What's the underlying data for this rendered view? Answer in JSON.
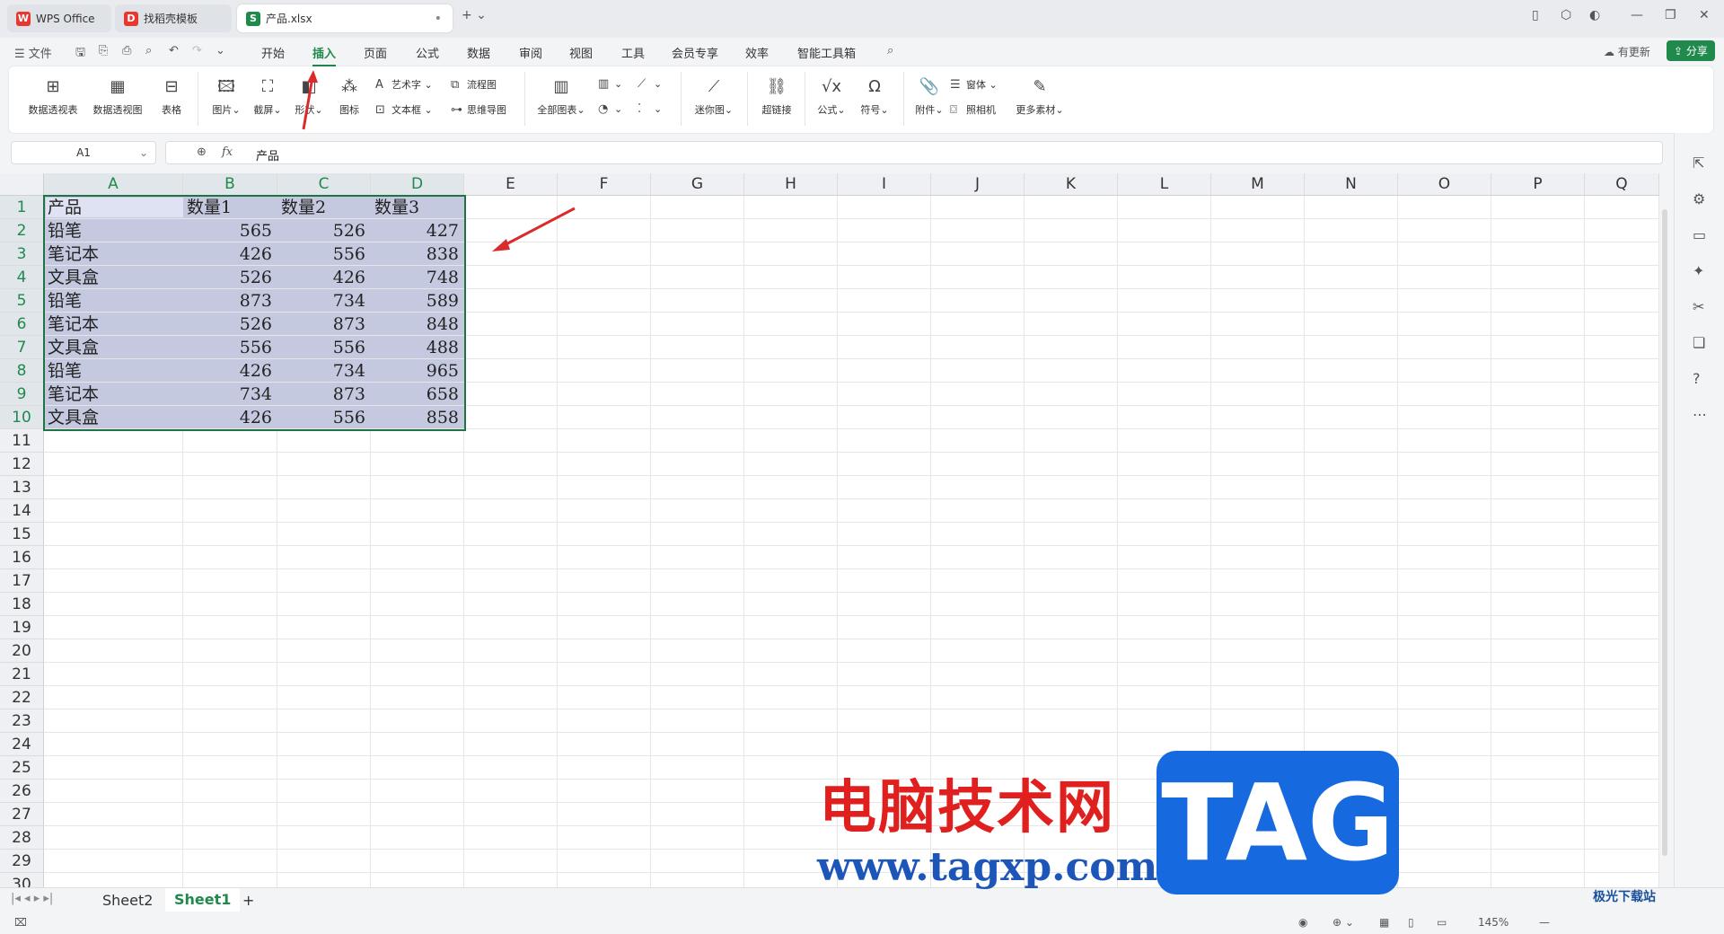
{
  "tabs": [
    {
      "label": "WPS Office",
      "icon": "W",
      "color": "#e7372f"
    },
    {
      "label": "找稻壳模板",
      "icon": "D",
      "color": "#e7372f"
    },
    {
      "label": "产品.xlsx",
      "icon": "S",
      "color": "#1f8a4c"
    }
  ],
  "menu": {
    "file": "文件",
    "items": [
      "开始",
      "插入",
      "页面",
      "公式",
      "数据",
      "审阅",
      "视图",
      "工具",
      "会员专享",
      "效率",
      "智能工具箱"
    ],
    "active": "插入",
    "update": "有更新",
    "share": "分享"
  },
  "ribbon": {
    "big": [
      "数据透视表",
      "数据透视图",
      "表格",
      "图片",
      "截屏",
      "形状",
      "图标",
      "全部图表",
      "迷你图",
      "超链接",
      "公式",
      "符号",
      "附件",
      "更多素材"
    ],
    "small": [
      "艺术字",
      "流程图",
      "文本框",
      "思维导图",
      "窗体",
      "照相机"
    ]
  },
  "formula": {
    "cell_ref": "A1",
    "fx": "fx",
    "value": "产品"
  },
  "columns": [
    "A",
    "B",
    "C",
    "D",
    "E",
    "F",
    "G",
    "H",
    "I",
    "J",
    "K",
    "L",
    "M",
    "N",
    "O",
    "P",
    "Q"
  ],
  "rows": [
    "1",
    "2",
    "3",
    "4",
    "5",
    "6",
    "7",
    "8",
    "9",
    "10",
    "11",
    "12",
    "13",
    "14",
    "15",
    "16",
    "17",
    "18",
    "19",
    "20",
    "21",
    "22",
    "23",
    "24",
    "25",
    "26",
    "27",
    "28",
    "29",
    "30"
  ],
  "table": [
    [
      "产品",
      "数量1",
      "数量2",
      "数量3"
    ],
    [
      "铅笔",
      "565",
      "526",
      "427"
    ],
    [
      "笔记本",
      "426",
      "556",
      "838"
    ],
    [
      "文具盒",
      "526",
      "426",
      "748"
    ],
    [
      "铅笔",
      "873",
      "734",
      "589"
    ],
    [
      "笔记本",
      "526",
      "873",
      "848"
    ],
    [
      "文具盒",
      "556",
      "556",
      "488"
    ],
    [
      "铅笔",
      "426",
      "734",
      "965"
    ],
    [
      "笔记本",
      "734",
      "873",
      "658"
    ],
    [
      "文具盒",
      "426",
      "556",
      "858"
    ]
  ],
  "sheets": [
    "Sheet2",
    "Sheet1"
  ],
  "active_sheet": "Sheet1",
  "status": {
    "zoom": "145%"
  },
  "watermark": {
    "cn": "电脑技术网",
    "url": "www.tagxp.com",
    "tag": "TAG",
    "site": "极光下载站"
  },
  "colors": {
    "accent": "#1f8a4c",
    "selection": "#c5c9e0",
    "arrow": "#d92b2b"
  }
}
